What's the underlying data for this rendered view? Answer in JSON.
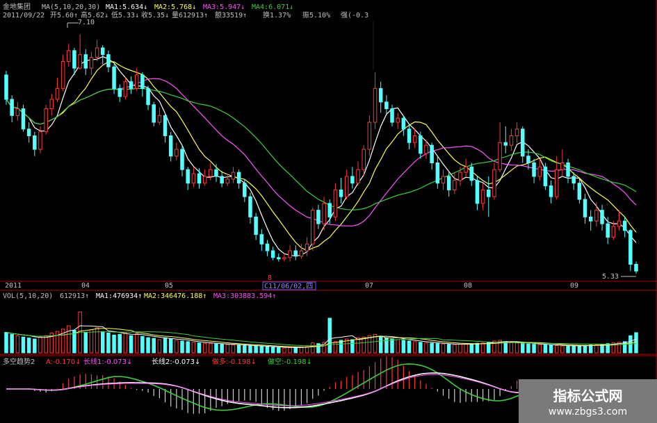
{
  "header": {
    "stock_name": "金地集团",
    "ma_param": "MA(5,10,20,30)",
    "ma1": "MA1:5.634↓",
    "ma2": "MA2:5.768↓",
    "ma3": "MA3:5.947↓",
    "ma4": "MA4:6.071↓",
    "date": "2011/09/22",
    "open": "开5.60↑",
    "high": "高5.62↓",
    "low": "低5.33↓",
    "close": "收5.35↓",
    "vol": "量612913↑",
    "amount": "额33519↑",
    "turnover": "换1.37%",
    "amplitude": "振5.10%",
    "strength": "强(-0.3"
  },
  "annotations": {
    "high_price": "7.10",
    "low_price": "5.33",
    "cursor_date": "C11/06/02,四",
    "cursor_marker": "8"
  },
  "vol_header": {
    "param": "VOL(5,10,20)",
    "vol": "612913↑",
    "ma1": "MA1:476934↑",
    "ma2": "MA2:346476.188↑",
    "ma3": "MA3:303883.594↑"
  },
  "ind_header": {
    "name": "多空趋势2",
    "a": "A:-0.170↓",
    "long1": "长线1:-0.073↓",
    "long2": "长线2:-0.073↓",
    "bull": "做多:-0.198↓",
    "bear": "做空:-0.198↓"
  },
  "watermark": {
    "title": "指标公式网",
    "url": "www.zbgs3.com"
  },
  "colors": {
    "up": "#ff3b3b",
    "down": "#54ffff",
    "ma5": "#ffffff",
    "ma10": "#ffff55",
    "ma20": "#ff55ff",
    "ma30": "#3cd13c",
    "axis": "#b00000",
    "label": "#c0c0c0"
  },
  "chart_data": {
    "type": "candlestick",
    "price_axis": {
      "ylim": [
        5.3,
        7.2
      ]
    },
    "x_tick_labels": [
      "2011",
      "04",
      "05",
      "07",
      "08",
      "09"
    ],
    "candles": [
      [
        6.8,
        6.62,
        6.83,
        6.58
      ],
      [
        6.62,
        6.5,
        6.65,
        6.45
      ],
      [
        6.5,
        6.55,
        6.6,
        6.46
      ],
      [
        6.55,
        6.4,
        6.58,
        6.38
      ],
      [
        6.4,
        6.35,
        6.45,
        6.3
      ],
      [
        6.35,
        6.25,
        6.38,
        6.2
      ],
      [
        6.25,
        6.38,
        6.42,
        6.22
      ],
      [
        6.38,
        6.55,
        6.58,
        6.36
      ],
      [
        6.55,
        6.62,
        6.66,
        6.5
      ],
      [
        6.62,
        6.7,
        6.78,
        6.6
      ],
      [
        6.7,
        6.9,
        6.95,
        6.68
      ],
      [
        6.9,
        6.98,
        7.03,
        6.86
      ],
      [
        6.98,
        6.85,
        7.0,
        6.8
      ],
      [
        6.85,
        6.95,
        7.1,
        6.84
      ],
      [
        6.95,
        6.85,
        6.99,
        6.8
      ],
      [
        6.85,
        6.93,
        6.97,
        6.8
      ],
      [
        6.93,
        7.0,
        7.06,
        6.9
      ],
      [
        7.0,
        6.95,
        7.02,
        6.88
      ],
      [
        6.95,
        6.86,
        6.98,
        6.82
      ],
      [
        6.86,
        6.7,
        6.88,
        6.66
      ],
      [
        6.7,
        6.64,
        6.73,
        6.6
      ],
      [
        6.64,
        6.75,
        6.78,
        6.62
      ],
      [
        6.75,
        6.7,
        6.79,
        6.66
      ],
      [
        6.7,
        6.8,
        6.85,
        6.68
      ],
      [
        6.8,
        6.7,
        6.82,
        6.64
      ],
      [
        6.7,
        6.58,
        6.72,
        6.54
      ],
      [
        6.58,
        6.45,
        6.6,
        6.42
      ],
      [
        6.45,
        6.5,
        6.56,
        6.43
      ],
      [
        6.5,
        6.35,
        6.52,
        6.3
      ],
      [
        6.35,
        6.2,
        6.38,
        6.16
      ],
      [
        6.2,
        6.25,
        6.3,
        6.17
      ],
      [
        6.25,
        6.1,
        6.28,
        6.05
      ],
      [
        6.1,
        6.0,
        6.12,
        5.95
      ],
      [
        6.0,
        6.07,
        6.12,
        5.97
      ],
      [
        6.07,
        6.0,
        6.11,
        5.96
      ],
      [
        6.0,
        6.05,
        6.1,
        5.98
      ],
      [
        6.05,
        6.1,
        6.15,
        6.02
      ],
      [
        6.1,
        6.05,
        6.14,
        6.01
      ],
      [
        6.05,
        6.0,
        6.09,
        5.97
      ],
      [
        6.0,
        6.03,
        6.07,
        5.98
      ],
      [
        6.03,
        6.08,
        6.12,
        6.0
      ],
      [
        6.08,
        6.0,
        6.1,
        5.96
      ],
      [
        6.0,
        5.9,
        6.03,
        5.86
      ],
      [
        5.9,
        5.75,
        5.93,
        5.7
      ],
      [
        5.75,
        5.62,
        5.78,
        5.58
      ],
      [
        5.62,
        5.55,
        5.66,
        5.5
      ],
      [
        5.55,
        5.5,
        5.58,
        5.46
      ],
      [
        5.5,
        5.45,
        5.53,
        5.43
      ],
      [
        5.45,
        5.44,
        5.48,
        5.42
      ],
      [
        5.44,
        5.45,
        5.48,
        5.42
      ],
      [
        5.45,
        5.5,
        5.54,
        5.42
      ],
      [
        5.5,
        5.46,
        5.54,
        5.43
      ],
      [
        5.46,
        5.5,
        5.55,
        5.44
      ],
      [
        5.5,
        5.55,
        5.6,
        5.46
      ],
      [
        5.55,
        5.8,
        5.82,
        5.5
      ],
      [
        5.8,
        5.7,
        5.84,
        5.66
      ],
      [
        5.7,
        5.85,
        5.9,
        5.65
      ],
      [
        5.85,
        5.75,
        5.88,
        5.7
      ],
      [
        5.75,
        5.95,
        6.0,
        5.72
      ],
      [
        5.95,
        5.9,
        6.04,
        5.85
      ],
      [
        5.9,
        6.05,
        6.1,
        5.88
      ],
      [
        6.05,
        6.0,
        6.12,
        5.96
      ],
      [
        6.0,
        6.1,
        6.16,
        5.98
      ],
      [
        6.1,
        6.25,
        6.28,
        6.05
      ],
      [
        6.25,
        6.45,
        6.5,
        6.2
      ],
      [
        6.45,
        6.7,
        6.82,
        6.4
      ],
      [
        6.7,
        6.6,
        6.75,
        6.52
      ],
      [
        6.6,
        6.55,
        6.65,
        6.5
      ],
      [
        6.55,
        6.45,
        6.58,
        6.42
      ],
      [
        6.45,
        6.48,
        6.52,
        6.4
      ],
      [
        6.48,
        6.4,
        6.5,
        6.35
      ],
      [
        6.4,
        6.3,
        6.43,
        6.25
      ],
      [
        6.3,
        6.35,
        6.4,
        6.26
      ],
      [
        6.35,
        6.22,
        6.38,
        6.18
      ],
      [
        6.22,
        6.28,
        6.32,
        6.18
      ],
      [
        6.28,
        6.15,
        6.3,
        6.1
      ],
      [
        6.15,
        6.0,
        6.2,
        5.96
      ],
      [
        6.0,
        6.05,
        6.1,
        5.95
      ],
      [
        6.05,
        5.95,
        6.08,
        5.9
      ],
      [
        5.95,
        6.02,
        6.08,
        5.92
      ],
      [
        6.02,
        6.08,
        6.12,
        5.98
      ],
      [
        6.08,
        6.12,
        6.18,
        6.05
      ],
      [
        6.12,
        6.02,
        6.15,
        5.98
      ],
      [
        6.02,
        5.85,
        6.05,
        5.8
      ],
      [
        5.85,
        5.95,
        6.0,
        5.8
      ],
      [
        5.95,
        5.9,
        6.05,
        5.75
      ],
      [
        5.9,
        6.1,
        6.15,
        5.88
      ],
      [
        6.1,
        6.3,
        6.45,
        6.08
      ],
      [
        6.3,
        6.28,
        6.42,
        6.22
      ],
      [
        6.28,
        6.35,
        6.4,
        6.24
      ],
      [
        6.35,
        6.4,
        6.45,
        6.3
      ],
      [
        6.4,
        6.2,
        6.42,
        6.15
      ],
      [
        6.2,
        6.15,
        6.25,
        6.1
      ],
      [
        6.15,
        6.05,
        6.18,
        6.0
      ],
      [
        6.05,
        6.12,
        6.18,
        6.02
      ],
      [
        6.12,
        5.98,
        6.15,
        5.95
      ],
      [
        5.98,
        5.9,
        6.02,
        5.85
      ],
      [
        5.9,
        6.1,
        6.2,
        5.88
      ],
      [
        6.1,
        6.15,
        6.25,
        6.05
      ],
      [
        6.15,
        6.05,
        6.18,
        6.0
      ],
      [
        6.05,
        6.0,
        6.08,
        5.95
      ],
      [
        6.0,
        5.88,
        6.03,
        5.85
      ],
      [
        5.88,
        5.75,
        5.92,
        5.7
      ],
      [
        5.75,
        5.72,
        5.8,
        5.65
      ],
      [
        5.72,
        5.8,
        5.86,
        5.68
      ],
      [
        5.8,
        5.7,
        5.84,
        5.65
      ],
      [
        5.7,
        5.6,
        5.75,
        5.55
      ],
      [
        5.6,
        5.68,
        5.72,
        5.58
      ],
      [
        5.68,
        5.72,
        5.8,
        5.65
      ],
      [
        5.72,
        5.65,
        5.75,
        5.6
      ],
      [
        5.65,
        5.4,
        5.66,
        5.35
      ],
      [
        5.4,
        5.35,
        5.42,
        5.33
      ]
    ],
    "volume_axis": {
      "ylim": [
        0,
        1600000
      ]
    },
    "volumes": [
      620000,
      560000,
      520000,
      480000,
      450000,
      420000,
      480000,
      520000,
      600000,
      650000,
      720000,
      820000,
      680000,
      1240000,
      620000,
      700000,
      760000,
      640000,
      600000,
      540000,
      560000,
      600000,
      520000,
      580000,
      500000,
      460000,
      440000,
      400000,
      460000,
      420000,
      380000,
      360000,
      340000,
      320000,
      300000,
      290000,
      280000,
      270000,
      260000,
      250000,
      240000,
      230000,
      220000,
      210000,
      200000,
      190000,
      180000,
      170000,
      160000,
      150000,
      160000,
      170000,
      180000,
      190000,
      300000,
      280000,
      320000,
      1050000,
      340000,
      380000,
      420000,
      400000,
      460000,
      480000,
      520000,
      560000,
      500000,
      460000,
      420000,
      400000,
      380000,
      360000,
      340000,
      320000,
      300000,
      290000,
      280000,
      270000,
      260000,
      250000,
      260000,
      270000,
      280000,
      290000,
      300000,
      320000,
      360000,
      380000,
      340000,
      320000,
      300000,
      280000,
      270000,
      260000,
      250000,
      240000,
      230000,
      220000,
      210000,
      200000,
      210000,
      220000,
      230000,
      240000,
      250000,
      260000,
      280000,
      300000,
      320000,
      340000,
      520000,
      612913
    ],
    "indicator_axis": {
      "ylim": [
        -0.9,
        0.6
      ]
    }
  }
}
